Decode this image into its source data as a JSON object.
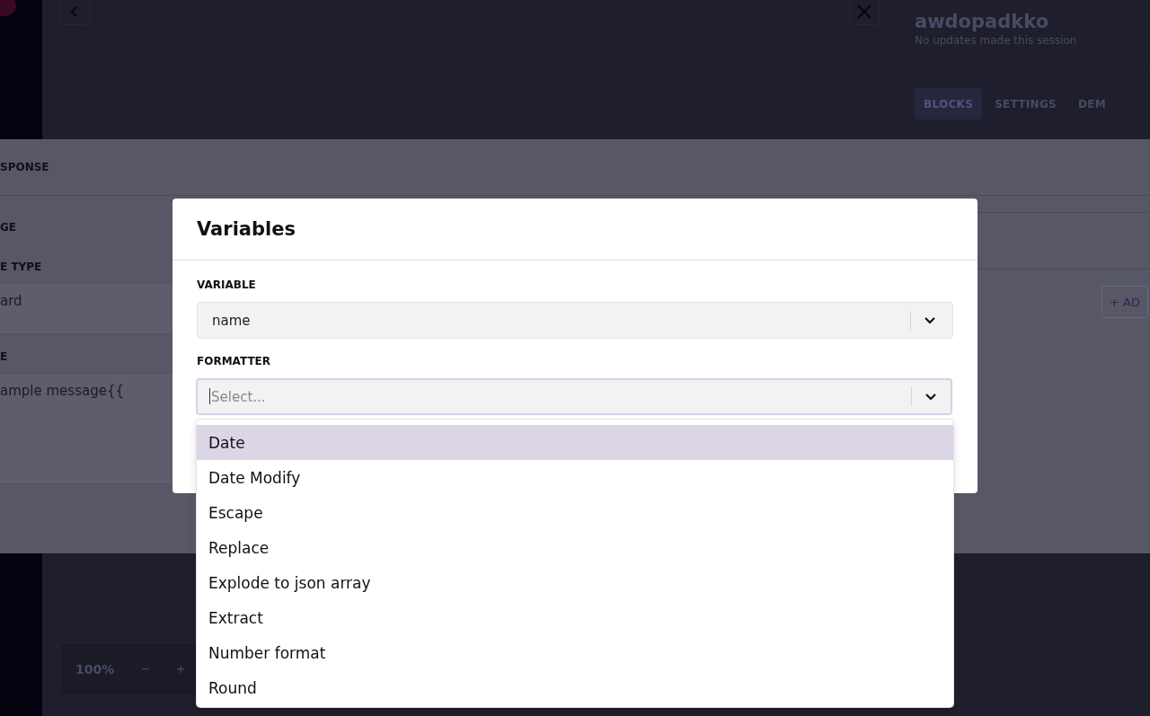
{
  "right_panel": {
    "title": "awdopadkko",
    "subtitle": "No updates made this session",
    "tabs": [
      {
        "label": "BLOCKS",
        "selected": true
      },
      {
        "label": "SETTINGS",
        "selected": false
      },
      {
        "label": "DEM",
        "selected": false
      }
    ]
  },
  "zoom": {
    "value": "100%",
    "decrease": "−",
    "increase": "+"
  },
  "response_modal": {
    "header": "SPONSE",
    "fields": [
      {
        "label": "GE"
      },
      {
        "label": "E TYPE",
        "value": "ard"
      },
      {
        "label": "E",
        "value": "ample message{{"
      }
    ],
    "add_button": "+ AD"
  },
  "variables_dialog": {
    "title": "Variables",
    "variable": {
      "label": "VARIABLE",
      "value": "name"
    },
    "formatter": {
      "label": "FORMATTER",
      "placeholder": "Select...",
      "options": [
        {
          "label": "Date",
          "selected": true
        },
        {
          "label": "Date Modify",
          "selected": false
        },
        {
          "label": "Escape",
          "selected": false
        },
        {
          "label": "Replace",
          "selected": false
        },
        {
          "label": "Explode to json array",
          "selected": false
        },
        {
          "label": "Extract",
          "selected": false
        },
        {
          "label": "Number format",
          "selected": false
        },
        {
          "label": "Round",
          "selected": false
        }
      ]
    }
  }
}
